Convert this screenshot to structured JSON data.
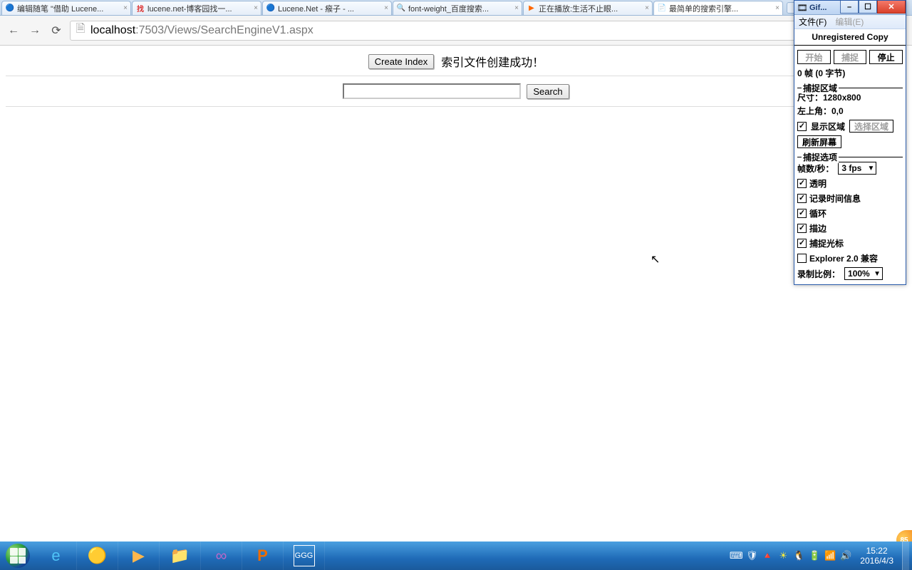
{
  "browser": {
    "tabs": [
      {
        "favicon": "🔵",
        "title": "编辑随笔 \"借助 Lucene..."
      },
      {
        "favicon": "找",
        "title": "lucene.net-博客园找一..."
      },
      {
        "favicon": "🔵",
        "title": "Lucene.Net - 瘊子 - ..."
      },
      {
        "favicon": "🔍",
        "title": "font-weight_百度搜索..."
      },
      {
        "favicon": "▶",
        "title": "正在播放:生活不止眼..."
      },
      {
        "favicon": "📄",
        "title": "最简单的搜索引擎..."
      }
    ],
    "nav": {
      "back": "←",
      "forward": "→",
      "reload": "⟳"
    },
    "url": {
      "host": "localhost",
      "rest": ":7503/Views/SearchEngineV1.aspx"
    }
  },
  "page": {
    "create_index_btn": "Create Index",
    "status_text": "索引文件创建成功！",
    "search_value": "",
    "search_btn": "Search"
  },
  "gif": {
    "title": "Gif...",
    "menu_file": "文件(F)",
    "menu_edit": "编辑(E)",
    "unregistered": "Unregistered Copy",
    "btn_start": "开始",
    "btn_capture": "捕捉",
    "btn_stop": "停止",
    "status": "0 帧 (0 字节)",
    "region_legend": "捕捉区域",
    "size_label": "尺寸：1280x800",
    "topleft_label": "左上角：0,0",
    "show_region_chk": "显示区域",
    "select_region_btn": "选择区域",
    "refresh_btn": "刷新屏幕",
    "options_legend": "捕捉选项",
    "fps_label": "帧数/秒：",
    "fps_value": "3 fps",
    "chk_transparent": "透明",
    "chk_time": "记录时间信息",
    "chk_loop": "循环",
    "chk_stroke": "描边",
    "chk_cursor": "捕捉光标",
    "chk_explorer": "Explorer 2.0 兼容",
    "scale_label": "录制比例：",
    "scale_value": "100%"
  },
  "taskbar": {
    "tray_icons": [
      "⌨",
      "🛡",
      "🔺",
      "☀",
      "🐧",
      "🔋",
      "📶",
      "🔊"
    ],
    "time": "15:22",
    "date": "2016/4/3"
  },
  "badge": "85"
}
